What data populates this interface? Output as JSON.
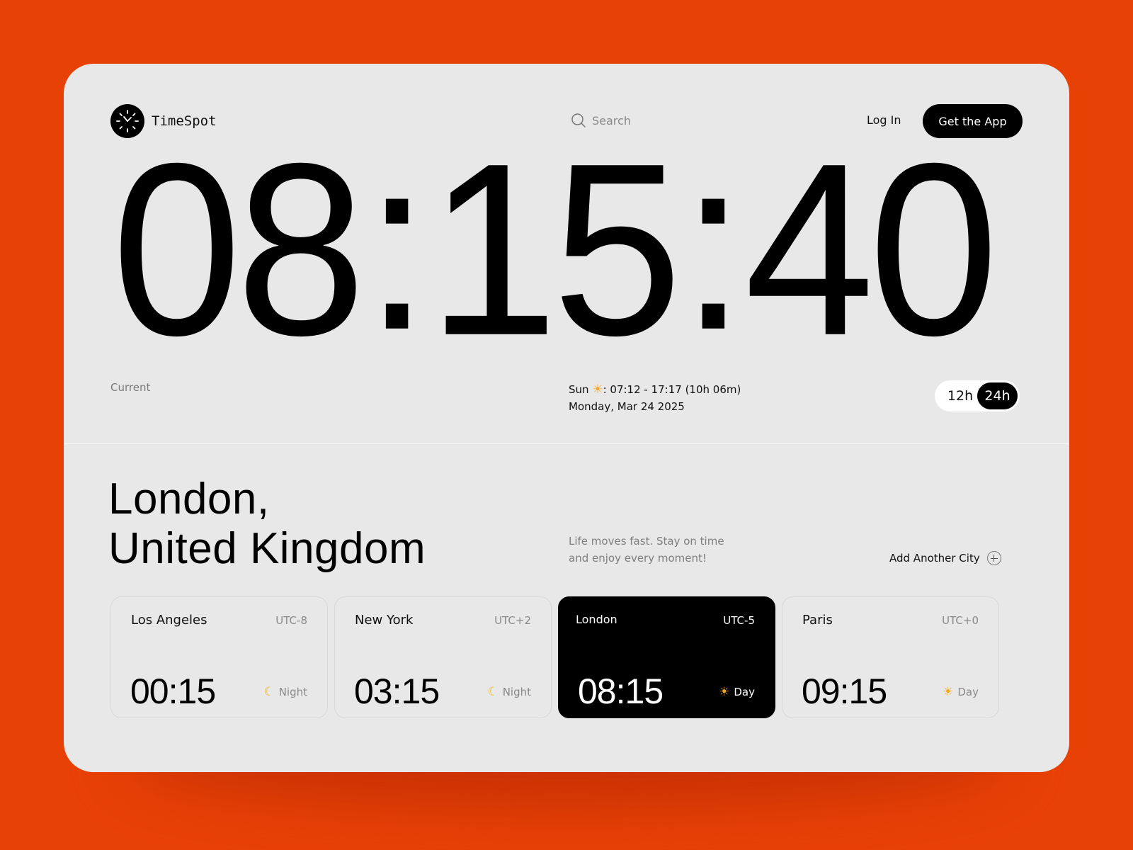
{
  "brand": {
    "name": "TimeSpot"
  },
  "header": {
    "search_placeholder": "Search",
    "login_label": "Log In",
    "get_app_label": "Get the App"
  },
  "clock": {
    "hours": "08",
    "minutes": "15",
    "seconds": "40",
    "separator": ":"
  },
  "meta": {
    "current_label": "Current",
    "sun_prefix": "Sun",
    "sun_range": ": 07:12 - 17:17 (10h 06m)",
    "date": "Monday, Mar 24 2025"
  },
  "format_toggle": {
    "option_12": "12h",
    "option_24": "24h",
    "selected": "24h"
  },
  "location": {
    "line1": "London,",
    "line2": "United Kingdom",
    "tagline_1": "Life moves fast. Stay on time",
    "tagline_2": "and enjoy every moment!",
    "add_city_label": "Add Another City"
  },
  "cities": [
    {
      "name": "Los Angeles",
      "utc": "UTC-8",
      "time": "00:15",
      "state": "Night",
      "icon": "moon-icon",
      "active": false
    },
    {
      "name": "New York",
      "utc": "UTC+2",
      "time": "03:15",
      "state": "Night",
      "icon": "moon-icon",
      "active": false
    },
    {
      "name": "London",
      "utc": "UTC-5",
      "time": "08:15",
      "state": "Day",
      "icon": "sun-icon",
      "active": true
    },
    {
      "name": "Paris",
      "utc": "UTC+0",
      "time": "09:15",
      "state": "Day",
      "icon": "sun-icon",
      "active": false
    }
  ],
  "colors": {
    "background": "#e84106",
    "card": "#e8e8e8",
    "accent": "#000000"
  }
}
